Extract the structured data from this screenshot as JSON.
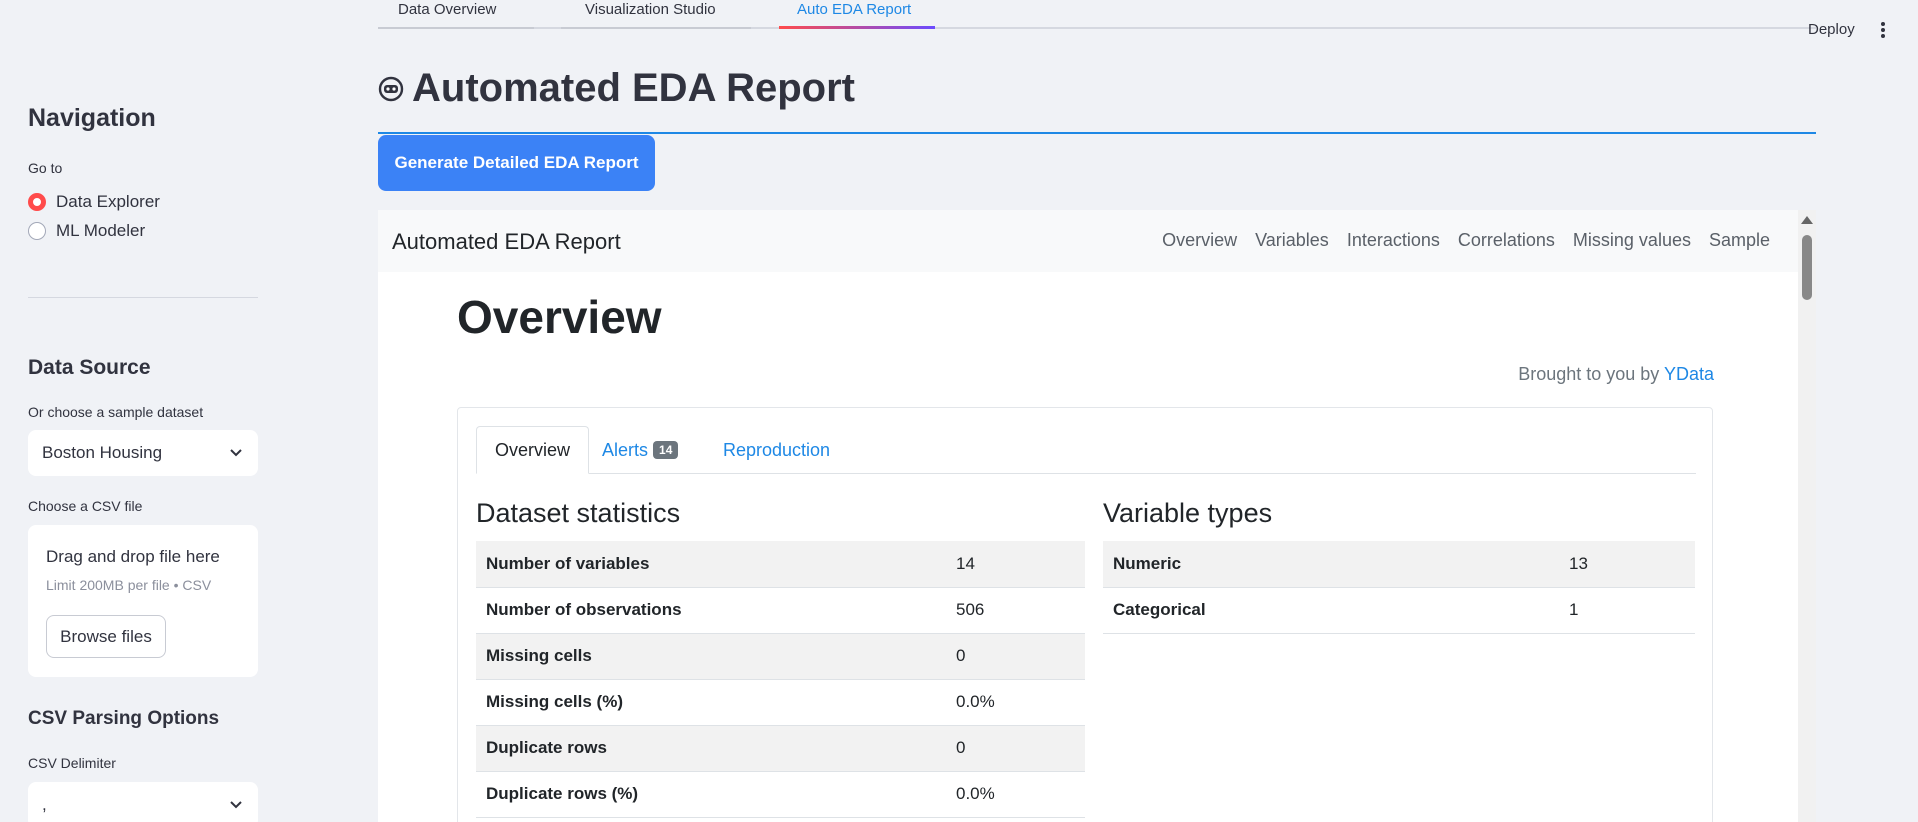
{
  "top_tabs": [
    {
      "label": "Data Overview"
    },
    {
      "label": "Visualization Studio"
    },
    {
      "label": "Auto EDA Report"
    }
  ],
  "header": {
    "deploy_label": "Deploy"
  },
  "sidebar": {
    "nav_title": "Navigation",
    "goto_label": "Go to",
    "radio_options": [
      {
        "label": "Data Explorer",
        "selected": true
      },
      {
        "label": "ML Modeler",
        "selected": false
      }
    ],
    "data_source_title": "Data Source",
    "sample_label": "Or choose a sample dataset",
    "sample_value": "Boston Housing",
    "csv_label": "Choose a CSV file",
    "uploader_title": "Drag and drop file here",
    "uploader_limit": "Limit 200MB per file • CSV",
    "browse_label": "Browse files",
    "csv_options_title": "CSV Parsing Options",
    "delimiter_label": "CSV Delimiter",
    "delimiter_value": ","
  },
  "main": {
    "title": "Automated EDA Report",
    "generate_button": "Generate Detailed EDA Report"
  },
  "report": {
    "brand": "Automated EDA Report",
    "nav_links": [
      "Overview",
      "Variables",
      "Interactions",
      "Correlations",
      "Missing values",
      "Sample"
    ],
    "overview_heading": "Overview",
    "brought_prefix": "Brought to you by",
    "brought_link": "YData",
    "tabs": {
      "overview": "Overview",
      "alerts": "Alerts",
      "alerts_count": "14",
      "reproduction": "Reproduction"
    },
    "dataset_statistics": {
      "title": "Dataset statistics",
      "rows": [
        {
          "label": "Number of variables",
          "value": "14"
        },
        {
          "label": "Number of observations",
          "value": "506"
        },
        {
          "label": "Missing cells",
          "value": "0"
        },
        {
          "label": "Missing cells (%)",
          "value": "0.0%"
        },
        {
          "label": "Duplicate rows",
          "value": "0"
        },
        {
          "label": "Duplicate rows (%)",
          "value": "0.0%"
        }
      ]
    },
    "variable_types": {
      "title": "Variable types",
      "rows": [
        {
          "label": "Numeric",
          "value": "13"
        },
        {
          "label": "Categorical",
          "value": "1"
        }
      ]
    }
  },
  "colors": {
    "accent": "#ff4b4b",
    "primary_button": "#3b82f6",
    "link": "#1e88e5"
  }
}
